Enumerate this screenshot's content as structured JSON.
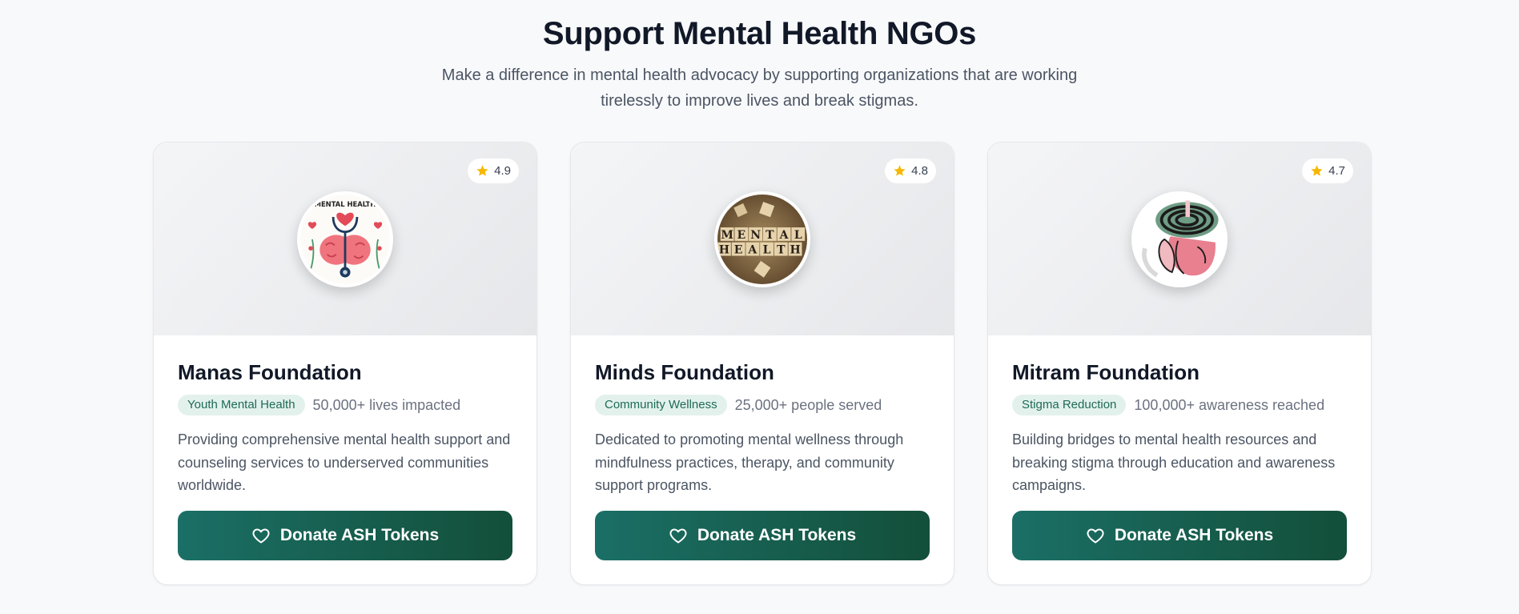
{
  "header": {
    "title": "Support Mental Health NGOs",
    "subtitle": "Make a difference in mental health advocacy by supporting organizations that are working tirelessly to improve lives and break stigmas."
  },
  "cards": [
    {
      "name": "Manas Foundation",
      "rating": "4.9",
      "tag": "Youth Mental Health",
      "impact": "50,000+ lives impacted",
      "description": "Providing comprehensive mental health support and counseling services to underserved communities worldwide.",
      "button_label": "Donate ASH Tokens",
      "image_icon": "brain-stethoscope-illustration",
      "image_text": "MENTAL HEALTH"
    },
    {
      "name": "Minds Foundation",
      "rating": "4.8",
      "tag": "Community Wellness",
      "impact": "25,000+ people served",
      "description": "Dedicated to promoting mental wellness through mindfulness practices, therapy, and community support programs.",
      "button_label": "Donate ASH Tokens",
      "image_icon": "letter-tiles-photo",
      "image_text": "MENTAL HEALTH"
    },
    {
      "name": "Mitram Foundation",
      "rating": "4.7",
      "tag": "Stigma Reduction",
      "impact": "100,000+ awareness reached",
      "description": "Building bridges to mental health resources and breaking stigma through education and awareness campaigns.",
      "button_label": "Donate ASH Tokens",
      "image_icon": "head-in-hands-illustration",
      "image_text": ""
    }
  ],
  "colors": {
    "accent_start": "#1b6f66",
    "accent_end": "#134f3a",
    "tag_bg": "#e3f1ec",
    "tag_text": "#1e6b56",
    "star": "#f5b800"
  }
}
